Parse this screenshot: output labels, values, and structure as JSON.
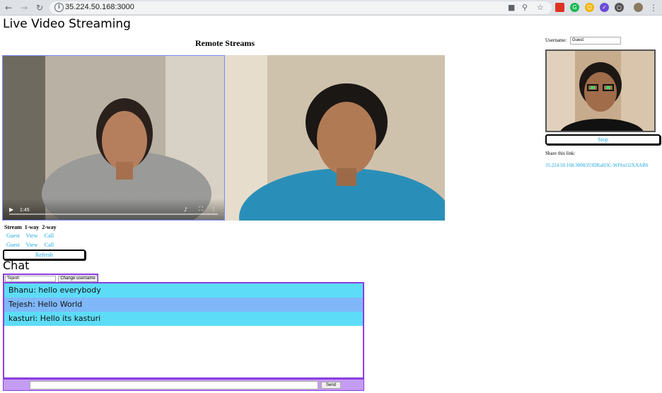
{
  "browser": {
    "url": "35.224.50.168:3000",
    "back_icon": "arrow-left-icon",
    "forward_icon": "arrow-right-icon",
    "reload_icon": "reload-icon"
  },
  "page": {
    "title": "Live Video Streaming",
    "remote_title": "Remote Streams"
  },
  "remote_video": {
    "current_time": "1:45"
  },
  "streams_table": {
    "headers": [
      "Stream",
      "1-way",
      "2-way"
    ],
    "rows": [
      {
        "stream": "Guest",
        "one_way": "View",
        "two_way": "Call"
      },
      {
        "stream": "Guest",
        "one_way": "View",
        "two_way": "Call"
      }
    ]
  },
  "refresh_label": "Refresh",
  "chat": {
    "title": "Chat",
    "username_value": "Tejesh",
    "change_username_label": "Change username",
    "messages": [
      "Bhanu: hello everybody",
      "Tejesh: Hello World",
      "kasturi: Hello its kasturi"
    ],
    "send_label": "Send"
  },
  "local": {
    "username_label": "Username:",
    "username_value": "Guest",
    "stop_label": "Stop",
    "share_label": "Share this link:",
    "share_link": "35.224.50.168:3000/ZODRaH3C-WFbxO2XAABS"
  },
  "colors": {
    "link": "#1ca8e3",
    "chat_border": "#8a3ee0",
    "msg_cyan": "#5ddcf7",
    "msg_blue": "#7fb7f9"
  }
}
